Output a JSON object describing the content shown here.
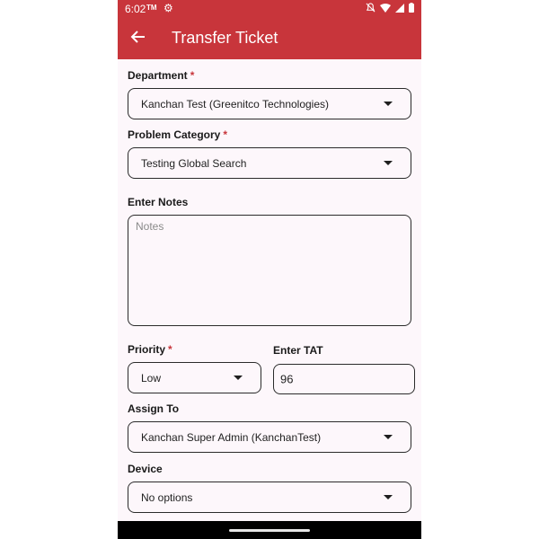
{
  "status_bar": {
    "time": "6:02",
    "tm_badge": "TM"
  },
  "header": {
    "title": "Transfer Ticket"
  },
  "form": {
    "department": {
      "label": "Department",
      "required_mark": "*",
      "value": "Kanchan Test (Greenitco Technologies)"
    },
    "problem_category": {
      "label": "Problem Category",
      "required_mark": "*",
      "value": "Testing Global Search"
    },
    "notes": {
      "label": "Enter Notes",
      "placeholder": "Notes"
    },
    "priority": {
      "label": "Priority",
      "required_mark": "*",
      "value": "Low"
    },
    "tat": {
      "label": "Enter TAT",
      "value": "96"
    },
    "assign_to": {
      "label": "Assign To",
      "value": "Kanchan Super Admin (KanchanTest)"
    },
    "device": {
      "label": "Device",
      "value": "No options"
    }
  },
  "colors": {
    "brand": "#c8353b",
    "background": "#fdf7fb"
  }
}
